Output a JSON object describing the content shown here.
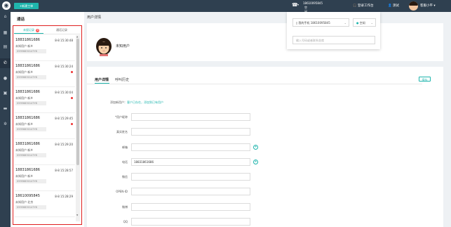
{
  "topbar": {
    "new_order_label": "+新建工单",
    "call": {
      "number": "18610095845",
      "status": "空闲"
    },
    "workstation_label": "登录工作台",
    "test_label": "测试",
    "user_name": "客服小平 ▾"
  },
  "panel": {
    "title": "通话",
    "tabs": [
      {
        "label": "未接记录",
        "badge": "6"
      },
      {
        "label": "通话记录"
      }
    ],
    "items": [
      {
        "phone": "18831861686",
        "time": "8-8 15:30:48",
        "loc": "未知用户 新乡",
        "missed": false,
        "mid": "05956830147Y8"
      },
      {
        "phone": "18831861686",
        "time": "8-8 15:30:24",
        "loc": "未知用户 新乡",
        "missed": true,
        "mid": "05956830147Y8"
      },
      {
        "phone": "18831861686",
        "time": "8-8 15:30:04",
        "loc": "未知用户 新乡",
        "missed": true,
        "mid": "05956830147Y8"
      },
      {
        "phone": "18831861686",
        "time": "8-8 15:29:45",
        "loc": "未知用户 新乡",
        "missed": true,
        "mid": "05956830147Y8"
      },
      {
        "phone": "18831861686",
        "time": "8-8 15:29:20",
        "loc": "未知用户 新乡",
        "missed": false,
        "mid": "05956830147Y8"
      },
      {
        "phone": "18831861686",
        "time": "8-8 15:28:57",
        "loc": "未知用户 新乡",
        "missed": false,
        "mid": "05956830147Y8"
      },
      {
        "phone": "18610095845",
        "time": "8-8 15:28:29",
        "loc": "未知用户 北京",
        "missed": false,
        "mid": "05956830147Y8"
      }
    ]
  },
  "details": {
    "title": "用户详情",
    "unknown_user": "未知用户",
    "tab_detail": "用户详情",
    "tab_history": "呼叫历史",
    "save_label": "保存",
    "add_new_prefix": "添加新用户：",
    "add_new_link": "客户已存在，添加到已有用户",
    "fields": [
      {
        "label": "*用户昵称",
        "value": ""
      },
      {
        "label": "真实姓名",
        "value": ""
      },
      {
        "label": "邮箱",
        "value": ""
      },
      {
        "label": "电话",
        "value": "18831861686"
      },
      {
        "label": "微信",
        "value": ""
      },
      {
        "label": "OPEN-ID",
        "value": ""
      },
      {
        "label": "微博",
        "value": ""
      },
      {
        "label": "QQ",
        "value": ""
      }
    ]
  },
  "popup": {
    "phone_select": "我的手机 18610095845",
    "status_select": "空闲",
    "number_placeholder": "输入号码或者联系坐席"
  },
  "colors": {
    "teal": "#1fb5ad",
    "nav": "#2f4050",
    "missed_dot": "#e33",
    "frame": "#e02020"
  }
}
